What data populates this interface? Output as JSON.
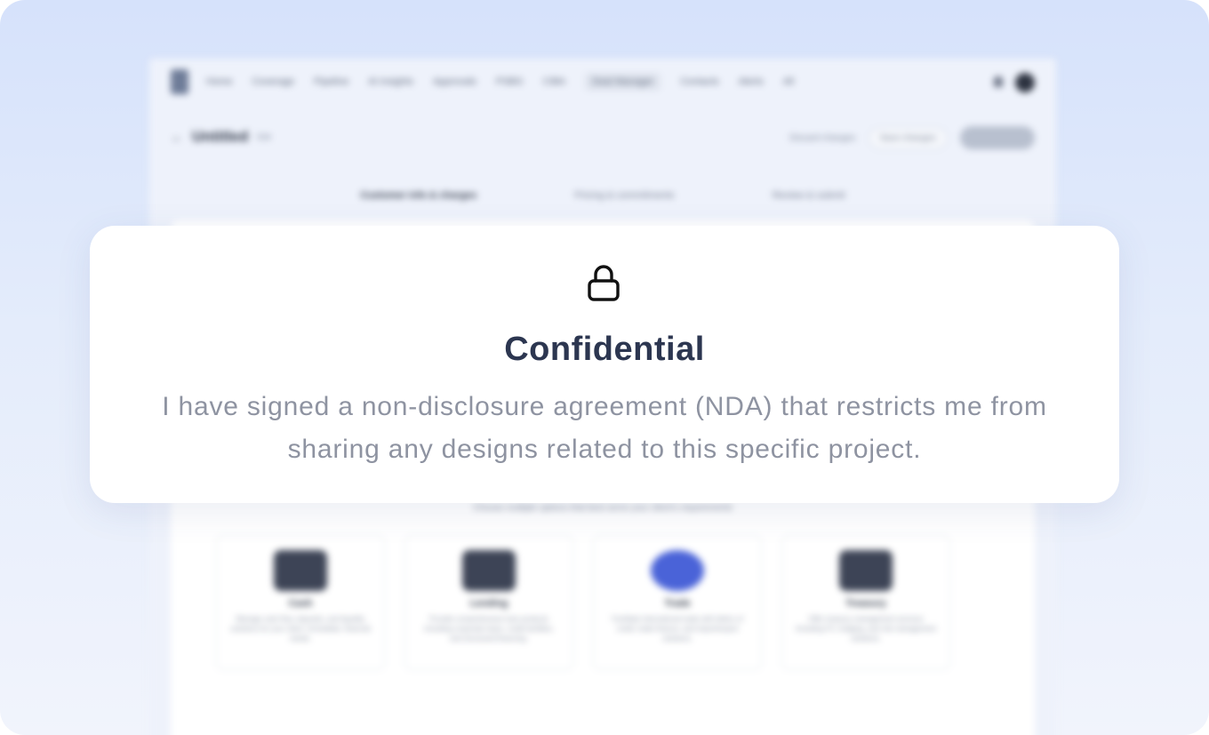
{
  "app": {
    "nav": [
      "Home",
      "Coverage",
      "Pipeline",
      "AI insights",
      "Approvals",
      "PSBG",
      "CIBA",
      "Deal Manager",
      "Contacts",
      "Alerts",
      "All"
    ],
    "active_nav": "Deal Manager",
    "page_title": "Untitled",
    "page_tag": "Edit",
    "discard_label": "Discard changes",
    "save_label": "Save changes",
    "steps": [
      "Customer info & charges",
      "Pricing & commitments",
      "Review & submit"
    ],
    "hint": "Choose multiple options that best serve your client's requirements",
    "cards": [
      {
        "name": "Cash",
        "desc": "Manage cash flow, deposits, and liquidity solutions for your client. Immediate, financial needs."
      },
      {
        "name": "Lending",
        "desc": "Provide comprehensive loan products including corporate loans, credit facilities, and structured financing."
      },
      {
        "name": "Trade",
        "desc": "Facilitate international trade with letters of credit, trade finance, and import/export solutions."
      },
      {
        "name": "Treasury",
        "desc": "Offer treasury management services including FX, hedging, and risk management solutions."
      }
    ]
  },
  "overlay": {
    "icon": "lock-icon",
    "title": "Confidential",
    "line1": "I have signed a non-disclosure agreement (NDA) that restricts me from",
    "line2": "sharing any designs related to this specific project."
  },
  "colors": {
    "title": "#2c3650",
    "body": "#8e93a1",
    "background_top": "#d6e2fb"
  }
}
